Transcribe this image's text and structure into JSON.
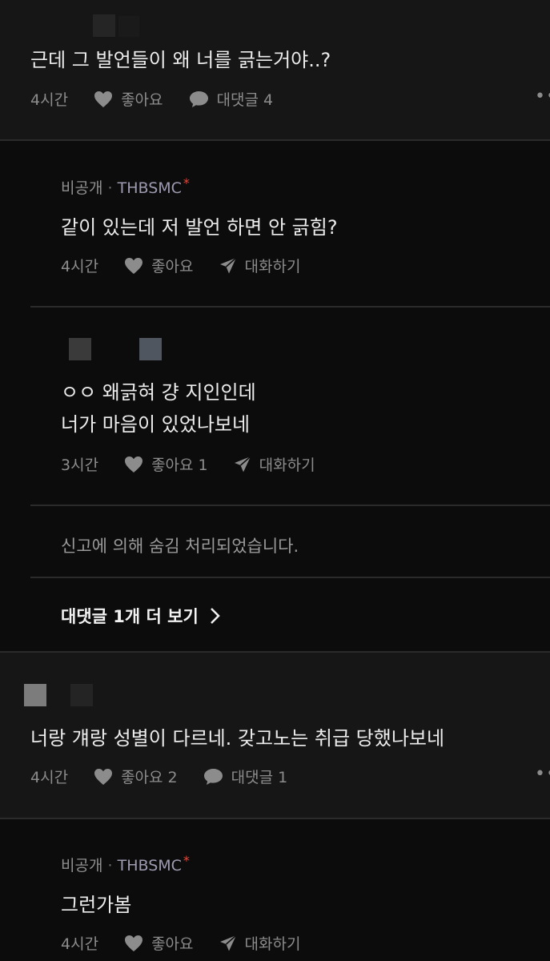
{
  "comments": [
    {
      "text": "근데 그 발언들이 왜 너를 긁는거야..?",
      "time": "4시간",
      "like_label": "좋아요",
      "reply_label": "대댓글 4"
    },
    {
      "text": "너랑 걔랑 성별이 다르네. 갖고노는 취급 당했나보네",
      "time": "4시간",
      "like_label": "좋아요 2",
      "reply_label": "대댓글 1"
    }
  ],
  "replies": [
    {
      "author_private": "비공개",
      "separator": "·",
      "author_name": "THBSMC",
      "author_mark": "*",
      "text": "같이 있는데 저 발언 하면 안 긁힘?",
      "time": "4시간",
      "like_label": "좋아요",
      "chat_label": "대화하기"
    },
    {
      "text_line1": "ㅇㅇ 왜긁혀 걍 지인인데",
      "text_line2": "너가 마음이 있었나보네",
      "time": "3시간",
      "like_label": "좋아요 1",
      "chat_label": "대화하기"
    },
    {
      "author_private": "비공개",
      "separator": "·",
      "author_name": "THBSMC",
      "author_mark": "*",
      "text": "그런가봄",
      "time": "4시간",
      "like_label": "좋아요",
      "chat_label": "대화하기"
    }
  ],
  "hidden_note": "신고에 의해 숨김 처리되었습니다.",
  "more_replies_label": "대댓글 1개 더 보기",
  "more_dots": "••",
  "colors": {
    "background": "#0c0c0c",
    "comment_background": "#161616",
    "text_primary": "#ececec",
    "text_secondary": "#8c8c8c",
    "divider": "#2b2b2b",
    "author_accent": "#9e9ab0",
    "mark_red": "#e2483b"
  },
  "icons": [
    "heart-icon",
    "speech-bubble-icon",
    "paper-plane-icon",
    "chevron-right-icon",
    "more-icon"
  ]
}
